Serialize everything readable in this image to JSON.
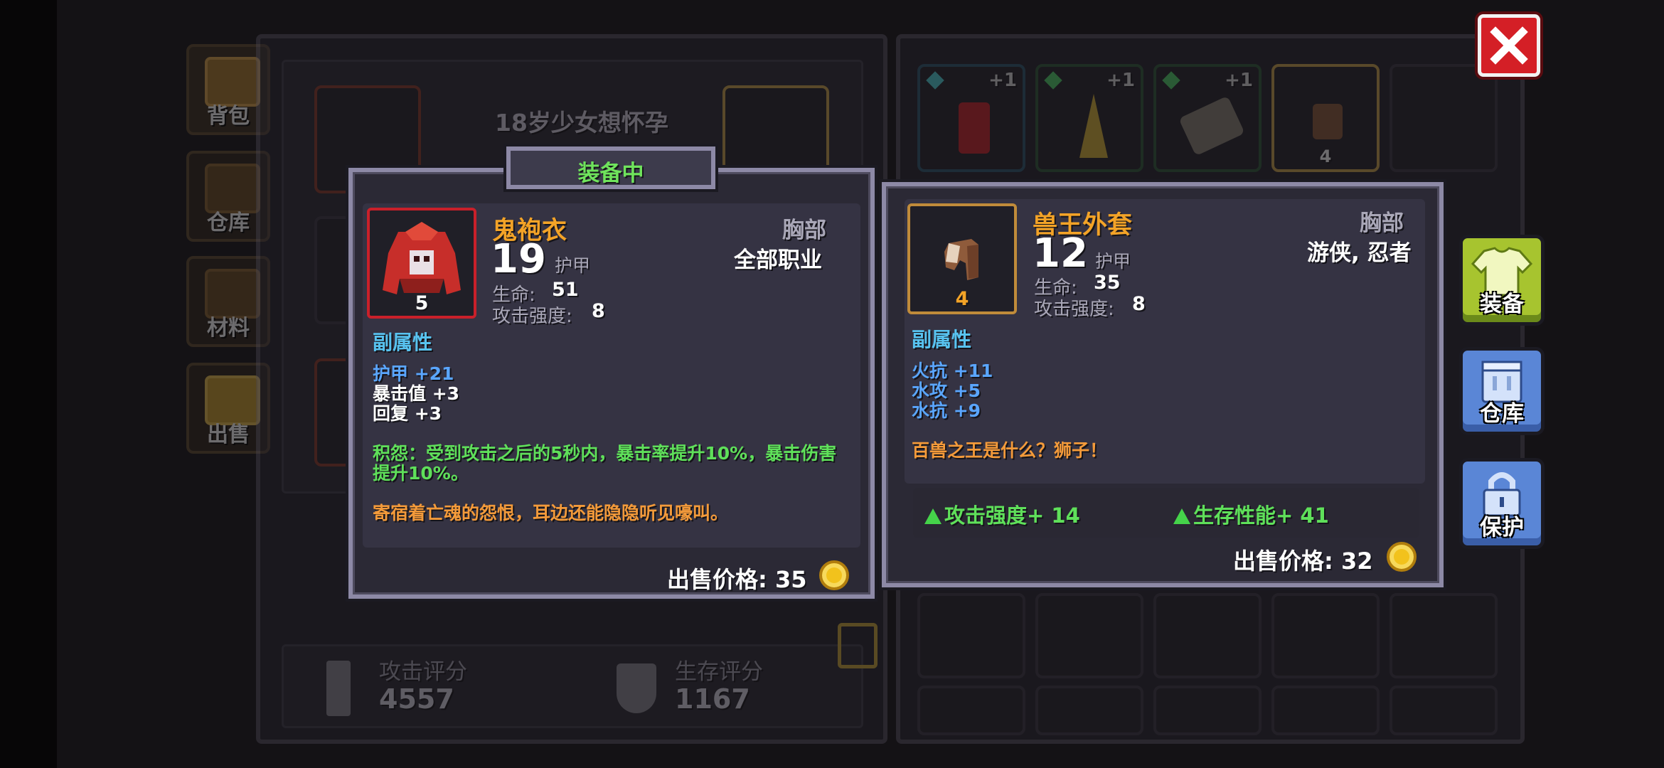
{
  "side_tabs": [
    {
      "label": "背包"
    },
    {
      "label": "仓库"
    },
    {
      "label": "材料"
    },
    {
      "label": "出售"
    }
  ],
  "character": {
    "name": "18岁少女想怀孕"
  },
  "scores": {
    "attack_label": "攻击评分",
    "attack_value": "4557",
    "survival_label": "生存评分",
    "survival_value": "1167"
  },
  "inventory_top": [
    {
      "plus": "+1",
      "gem": "cyan-gem-icon"
    },
    {
      "plus": "+1",
      "gem": "green-gem-icon"
    },
    {
      "plus": "+1",
      "gem": "green-gem-icon"
    },
    {
      "count": "4"
    }
  ],
  "equipped": {
    "header": "装备中",
    "name": "鬼袍衣",
    "slot": "胸部",
    "class": "全部职业",
    "armor": "19",
    "armor_label": "护甲",
    "hp_label": "生命:",
    "hp": "51",
    "atk_label": "攻击强度:",
    "atk": "8",
    "level": "5",
    "sub_title": "副属性",
    "subs": [
      {
        "text": "护甲 +21",
        "color": "blue"
      },
      {
        "text": "暴击值 +3",
        "color": "white"
      },
      {
        "text": "回复 +3",
        "color": "white"
      }
    ],
    "effect_line1": "积怨：受到攻击之后的5秒内，暴击率提升10%，暴击伤害",
    "effect_line2": "提升10%。",
    "flavor": "寄宿着亡魂的怨恨，耳边还能隐隐听见嚎叫。",
    "price_label": "出售价格: 35"
  },
  "compare": {
    "name": "兽王外套",
    "slot": "胸部",
    "class": "游侠, 忍者",
    "armor": "12",
    "armor_label": "护甲",
    "hp_label": "生命:",
    "hp": "35",
    "atk_label": "攻击强度:",
    "atk": "8",
    "level": "4",
    "sub_title": "副属性",
    "subs": [
      {
        "text": "火抗 +11"
      },
      {
        "text": "水攻 +5"
      },
      {
        "text": "水抗 +9"
      }
    ],
    "flavor": "百兽之王是什么？狮子！",
    "delta_atk": "攻击强度+ 14",
    "delta_survive": "生存性能+ 41",
    "price_label": "出售价格: 32"
  },
  "actions": [
    {
      "label": "装备"
    },
    {
      "label": "仓库"
    },
    {
      "label": "保护"
    }
  ],
  "colors": {
    "gold": "#f3a327",
    "cyan": "#58c3f0",
    "blue": "#5aa6ff",
    "green": "#5fe05a",
    "orange": "#f39a3a",
    "close": "#d41f26"
  }
}
